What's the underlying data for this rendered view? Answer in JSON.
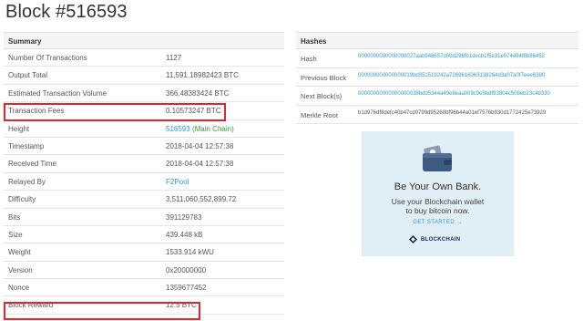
{
  "page": {
    "title": "Block #516593"
  },
  "summary": {
    "header": "Summary",
    "rows": [
      {
        "label": "Number Of Transactions",
        "value": "1127"
      },
      {
        "label": "Output Total",
        "value": "11,591.18982423 BTC"
      },
      {
        "label": "Estimated Transaction Volume",
        "value": "366.48383424 BTC"
      },
      {
        "label": "Transaction Fees",
        "value": "0.10573247 BTC"
      },
      {
        "label": "Height",
        "value": "516593",
        "suffix": "(Main Chain)"
      },
      {
        "label": "Timestamp",
        "value": "2018-04-04 12:57:38"
      },
      {
        "label": "Received Time",
        "value": "2018-04-04 12:57:38"
      },
      {
        "label": "Relayed By",
        "value": "F2Pool"
      },
      {
        "label": "Difficulty",
        "value": "3,511,060,552,899.72"
      },
      {
        "label": "Bits",
        "value": "391129783"
      },
      {
        "label": "Size",
        "value": "439.448 kB"
      },
      {
        "label": "Weight",
        "value": "1533.914 kWU"
      },
      {
        "label": "Version",
        "value": "0x20000000"
      },
      {
        "label": "Nonce",
        "value": "1359677452"
      },
      {
        "label": "Block Reward",
        "value": "12.5 BTC"
      }
    ]
  },
  "hashes": {
    "header": "Hashes",
    "rows": [
      {
        "label": "Hash",
        "value": "0000000000000000027aab948657d00d296fb1decb1f5e31e074494f8b86452"
      },
      {
        "label": "Previous Block",
        "value": "000000000000000019bd351519242a7269616063138264d3a07a0f7eee6380"
      },
      {
        "label": "Next Block(s)",
        "value": "00000000000000000038bdd5344a49e8eaa009c9e5bdf93804c508eb23c4b330"
      },
      {
        "label": "Merkle Root",
        "value": "b1d976df8defc40b47cd0799d95268bf96b44a01ef7576b930d1772425e73929"
      }
    ]
  },
  "ad": {
    "headline": "Be Your Own Bank.",
    "text_line1": "Use your Blockchain wallet",
    "text_line2": "to buy bitcoin now.",
    "cta": "GET STARTED →",
    "brand": "BLOCKCHAIN"
  },
  "colors": {
    "link": "#2e9ad0",
    "highlight": "#e0262c",
    "ad_bg": "#e0eef6",
    "main_chain": "#3c9a3c"
  }
}
